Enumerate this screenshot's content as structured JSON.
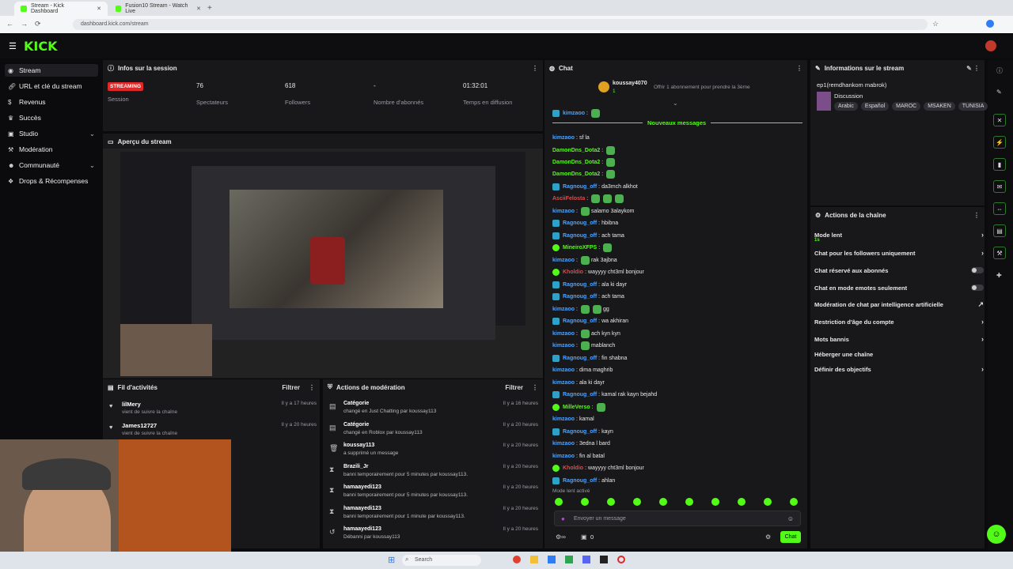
{
  "browser": {
    "tabs": [
      {
        "title": "Stream - Kick Dashboard",
        "active": true
      },
      {
        "title": "Fusion10 Stream - Watch Live",
        "active": false
      }
    ],
    "url": "dashboard.kick.com/stream"
  },
  "app": {
    "logo": "KICK",
    "accent": "#53fc18"
  },
  "sidebar": {
    "items": [
      {
        "label": "Stream",
        "icon": "broadcast-icon",
        "active": true
      },
      {
        "label": "URL et clé du stream",
        "icon": "link-icon"
      },
      {
        "label": "Revenus",
        "icon": "dollar-icon"
      },
      {
        "label": "Succès",
        "icon": "trophy-icon"
      },
      {
        "label": "Studio",
        "icon": "studio-icon",
        "expandable": true
      },
      {
        "label": "Modération",
        "icon": "gavel-icon"
      },
      {
        "label": "Communauté",
        "icon": "people-icon",
        "expandable": true
      },
      {
        "label": "Drops & Récompenses",
        "icon": "gift-icon"
      }
    ]
  },
  "session": {
    "title": "Infos sur la session",
    "status_badge": "STREAMING",
    "status_label": "Session",
    "stats": [
      {
        "value": "76",
        "label": "Spectateurs"
      },
      {
        "value": "618",
        "label": "Followers"
      },
      {
        "value": "-",
        "label": "Nombre d'abonnés"
      },
      {
        "value": "01:32:01",
        "label": "Temps en diffusion"
      }
    ]
  },
  "preview": {
    "title": "Aperçu du stream"
  },
  "activity": {
    "title": "Fil d'activités",
    "filter": "Filtrer",
    "items": [
      {
        "name": "lilMery",
        "desc": "vient de suivre la chaîne",
        "time": "Il y a 17 heures"
      },
      {
        "name": "James12727",
        "desc": "vient de suivre la chaîne",
        "time": "Il y a 20 heures"
      }
    ]
  },
  "moderation": {
    "title": "Actions de modération",
    "filter": "Filtrer",
    "items": [
      {
        "icon": "category-icon",
        "name": "Catégorie",
        "desc": "changé en Just Chatting par koussay113",
        "time": "Il y a 16 heures"
      },
      {
        "icon": "category-icon",
        "name": "Catégorie",
        "desc": "changé en Roblox par koussay113",
        "time": "Il y a 20 heures"
      },
      {
        "icon": "trash-icon",
        "name": "koussay113",
        "desc": "a supprimé un message",
        "time": "Il y a 20 heures"
      },
      {
        "icon": "hourglass-icon",
        "name": "Brazili_Jr",
        "desc": "banni temporairement pour 5 minutes par koussay113.",
        "time": "Il y a 20 heures"
      },
      {
        "icon": "hourglass-icon",
        "name": "hamaayedi123",
        "desc": "banni temporairement pour 5 minutes par koussay113.",
        "time": "Il y a 20 heures"
      },
      {
        "icon": "hourglass-icon",
        "name": "hamaayedi123",
        "desc": "banni temporairement pour 1 minute par koussay113.",
        "time": "Il y a 20 heures"
      },
      {
        "icon": "undo-icon",
        "name": "hamaayedi123",
        "desc": "Débanni par koussay113",
        "time": "Il y a 20 heures"
      }
    ]
  },
  "chat": {
    "title": "Chat",
    "pinned_user": "koussay4070",
    "pinned_count": "1",
    "pinned_text": "Offrir 1 abonnement pour prendre la 3ème",
    "new_messages": "Nouveaux messages",
    "messages": [
      {
        "user": "kimzaoo",
        "color": "#4ca3ff",
        "badge": "blue",
        "text": "",
        "emotes": 1
      },
      {
        "user": "kimzaoo",
        "color": "#4ca3ff",
        "badge": "",
        "text": "sf la",
        "emotes": 0
      },
      {
        "user": "DamonDns_Dota2",
        "color": "#53fc18",
        "badge": "",
        "text": "",
        "emotes": 1
      },
      {
        "user": "DamonDns_Dota2",
        "color": "#53fc18",
        "badge": "",
        "text": "",
        "emotes": 1
      },
      {
        "user": "DamonDns_Dota2",
        "color": "#53fc18",
        "badge": "",
        "text": "",
        "emotes": 1
      },
      {
        "user": "Ragnoug_off",
        "color": "#4ca3ff",
        "badge": "blue",
        "text": "da3mch alkhot",
        "emotes": 0
      },
      {
        "user": "AsciiFelosta",
        "color": "#e24a4a",
        "badge": "",
        "text": "",
        "emotes": 3
      },
      {
        "user": "kimzaoo",
        "color": "#4ca3ff",
        "badge": "",
        "text": "salamo 3alaykom",
        "emotes": 1
      },
      {
        "user": "Ragnoug_off",
        "color": "#4ca3ff",
        "badge": "blue",
        "text": "hbibna",
        "emotes": 0
      },
      {
        "user": "Ragnoug_off",
        "color": "#4ca3ff",
        "badge": "blue",
        "text": "ach tama",
        "emotes": 0
      },
      {
        "user": "MineiroXFPS",
        "color": "#53fc18",
        "badge": "green",
        "text": "",
        "emotes": 1
      },
      {
        "user": "kimzaoo",
        "color": "#4ca3ff",
        "badge": "",
        "text": "rak 3ajbna",
        "emotes": 1
      },
      {
        "user": "Kholdio",
        "color": "#e24a4a",
        "badge": "green",
        "text": "wayyyy cht3ml bonjour",
        "emotes": 0
      },
      {
        "user": "Ragnoug_off",
        "color": "#4ca3ff",
        "badge": "blue",
        "text": "ala ki dayr",
        "emotes": 0
      },
      {
        "user": "Ragnoug_off",
        "color": "#4ca3ff",
        "badge": "blue",
        "text": "ach tama",
        "emotes": 0
      },
      {
        "user": "kimzaoo",
        "color": "#4ca3ff",
        "badge": "",
        "text": "gg",
        "emotes": 2
      },
      {
        "user": "Ragnoug_off",
        "color": "#4ca3ff",
        "badge": "blue",
        "text": "wa akhiran",
        "emotes": 0
      },
      {
        "user": "kimzaoo",
        "color": "#4ca3ff",
        "badge": "",
        "text": "ach kyn kyn",
        "emotes": 1
      },
      {
        "user": "kimzaoo",
        "color": "#4ca3ff",
        "badge": "",
        "text": "mablanch",
        "emotes": 1
      },
      {
        "user": "Ragnoug_off",
        "color": "#4ca3ff",
        "badge": "blue",
        "text": "fin shabna",
        "emotes": 0
      },
      {
        "user": "kimzaoo",
        "color": "#4ca3ff",
        "badge": "",
        "text": "dima maghrib",
        "emotes": 0
      },
      {
        "user": "kimzaoo",
        "color": "#4ca3ff",
        "badge": "",
        "text": "ala ki dayr",
        "emotes": 0
      },
      {
        "user": "Ragnoug_off",
        "color": "#4ca3ff",
        "badge": "blue",
        "text": "kamal rak kayn bejahd",
        "emotes": 0
      },
      {
        "user": "MilleVerso",
        "color": "#53fc18",
        "badge": "green",
        "text": "",
        "emotes": 1
      },
      {
        "user": "kimzaoo",
        "color": "#4ca3ff",
        "badge": "",
        "text": "kamal",
        "emotes": 0
      },
      {
        "user": "Ragnoug_off",
        "color": "#4ca3ff",
        "badge": "blue",
        "text": "kayn",
        "emotes": 0
      },
      {
        "user": "kimzaoo",
        "color": "#4ca3ff",
        "badge": "",
        "text": "3edna l bard",
        "emotes": 0
      },
      {
        "user": "kimzaoo",
        "color": "#4ca3ff",
        "badge": "",
        "text": "fin al batal",
        "emotes": 0
      },
      {
        "user": "Kholdio",
        "color": "#e24a4a",
        "badge": "green",
        "text": "wayyyy cht3ml bonjour",
        "emotes": 0
      },
      {
        "user": "Ragnoug_off",
        "color": "#4ca3ff",
        "badge": "blue",
        "text": "ahlan",
        "emotes": 0
      }
    ],
    "slow_mode": "Mode lent activé",
    "input_placeholder": "Envoyer un message",
    "viewer_count": "0",
    "send_label": "Chat"
  },
  "stream_info": {
    "title": "Informations sur le stream",
    "stream_title": "ep1(remdhankom mabrok)",
    "category": "Discussion",
    "tags": [
      "Arabic",
      "Español",
      "MAROC",
      "MSAKEN",
      "TUNISIA"
    ]
  },
  "channel_actions": {
    "title": "Actions de la chaîne",
    "items": [
      {
        "label": "Mode lent",
        "sub": "1s",
        "control": "chevron"
      },
      {
        "label": "Chat pour les followers uniquement",
        "control": "chevron"
      },
      {
        "label": "Chat réservé aux abonnés",
        "control": "toggle"
      },
      {
        "label": "Chat en mode emotes seulement",
        "control": "toggle"
      },
      {
        "label": "Modération de chat par intelligence artificielle",
        "control": "external"
      },
      {
        "label": "Restriction d'âge du compte",
        "control": "chevron"
      },
      {
        "label": "Mots bannis",
        "control": "chevron"
      },
      {
        "label": "Héberger une chaîne",
        "control": "none"
      },
      {
        "label": "Définir des objectifs",
        "control": "chevron"
      }
    ]
  },
  "taskbar": {
    "search": "Search"
  }
}
